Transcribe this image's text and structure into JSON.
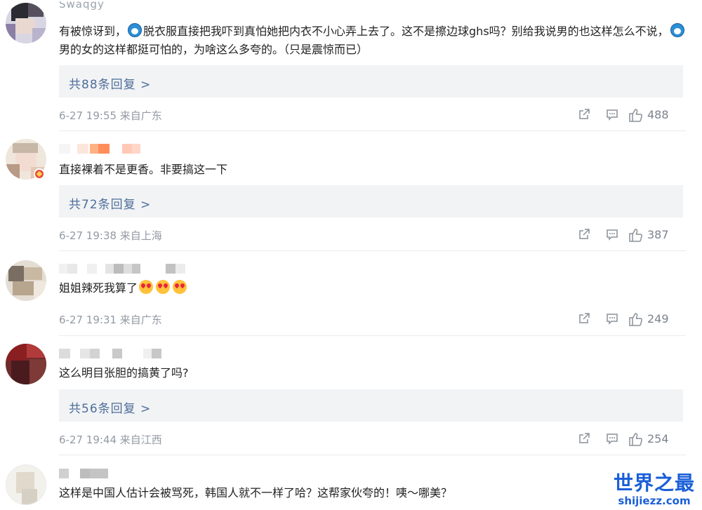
{
  "comments": [
    {
      "username": "Swaqgy",
      "text_parts": [
        "有被惊讶到，",
        "脱衣服直接把我吓到真怕她把内衣不小心弄上去了。这不是擦边球ghs吗？别给我说男的也这样怎么不说，",
        "男的女的这样都挺可怕的，为啥这么多夸的。（只是震惊而已）"
      ],
      "replies": "共88条回复 >",
      "meta": "6-27 19:55 来自广东",
      "likes": "488"
    },
    {
      "text": "直接裸着不是更香。非要搞这一下",
      "replies": "共72条回复 >",
      "meta": "6-27 19:38 来自上海",
      "likes": "387"
    },
    {
      "text": "姐姐辣死我算了",
      "meta": "6-27 19:31 来自广东",
      "likes": "249"
    },
    {
      "text": "这么明目张胆的搞黄了吗?",
      "replies": "共56条回复 >",
      "meta": "6-27 19:44 来自江西",
      "likes": "254"
    },
    {
      "text": "这样是中国人估计会被骂死，韩国人就不一样了哈？这帮家伙夸的！咦～哪美？"
    }
  ],
  "icons": {
    "share": "share-icon",
    "comment": "comment-icon",
    "like": "thumbs-up-icon",
    "doraemon": "doraemon-emoji-icon",
    "love": "heart-eyes-emoji-icon",
    "verified": "verified-badge-icon"
  },
  "watermark": {
    "title": "世界之最",
    "site": "shijiezz.com"
  },
  "colors": {
    "link": "#4d6e9a",
    "reply_bg": "#f2f3f5",
    "meta": "#939aa4",
    "watermark": "#1a5fd8"
  }
}
